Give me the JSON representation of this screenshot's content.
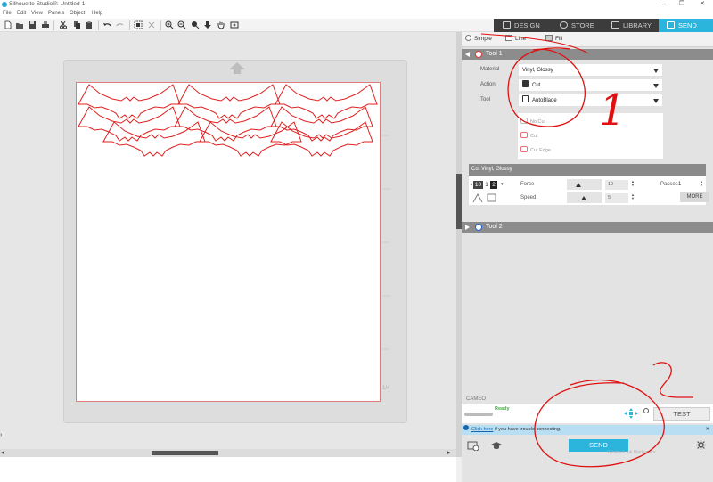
{
  "window": {
    "title": "Silhouette Studio®: Untitled-1",
    "controls": [
      "–",
      "❐",
      "✕"
    ]
  },
  "menu": [
    "File",
    "Edit",
    "View",
    "Panels",
    "Object",
    "Help"
  ],
  "nav_tabs": [
    {
      "label": "DESIGN",
      "icon": "design-icon"
    },
    {
      "label": "STORE",
      "icon": "store-icon"
    },
    {
      "label": "LIBRARY",
      "icon": "library-icon"
    },
    {
      "label": "SEND",
      "icon": "send-icon",
      "active": true
    }
  ],
  "panel": {
    "modes": [
      "Simple",
      "Line",
      "Fill"
    ],
    "tool1": {
      "header": "Tool 1",
      "circle_color": "#e53935",
      "material_label": "Material",
      "material_value": "Vinyl, Glossy",
      "action_label": "Action",
      "action_value": "Cut",
      "tool_label": "Tool",
      "tool_value": "AutoBlade",
      "actions": [
        "No Cut",
        "Cut",
        "Cut Edge"
      ]
    },
    "cut_settings": {
      "header": "Cut Vinyl, Glossy",
      "blade_digits": [
        "10",
        "1",
        "2"
      ],
      "force_label": "Force",
      "force_value": "10",
      "speed_label": "Speed",
      "speed_value": "5",
      "passes_label": "Passes",
      "passes_value": "1",
      "more_label": "MORE"
    },
    "tool2": {
      "header": "Tool 2",
      "circle_color": "#1e63d6"
    },
    "device_label": "CAMEO",
    "status": "Ready",
    "test_label": "TEST",
    "info": {
      "link": "Click here",
      "text": " if you have trouble connecting."
    },
    "send_label": "SEND",
    "watermark": "Windows Ink Workspace"
  },
  "ruler_mark": "1/4",
  "annotations": [
    "1",
    "2"
  ],
  "colors": {
    "accent": "#2bb4dc",
    "cut_line": "#e02020",
    "annotation": "#e01010",
    "tool1": "#e53935",
    "tool2": "#1e63d6"
  }
}
